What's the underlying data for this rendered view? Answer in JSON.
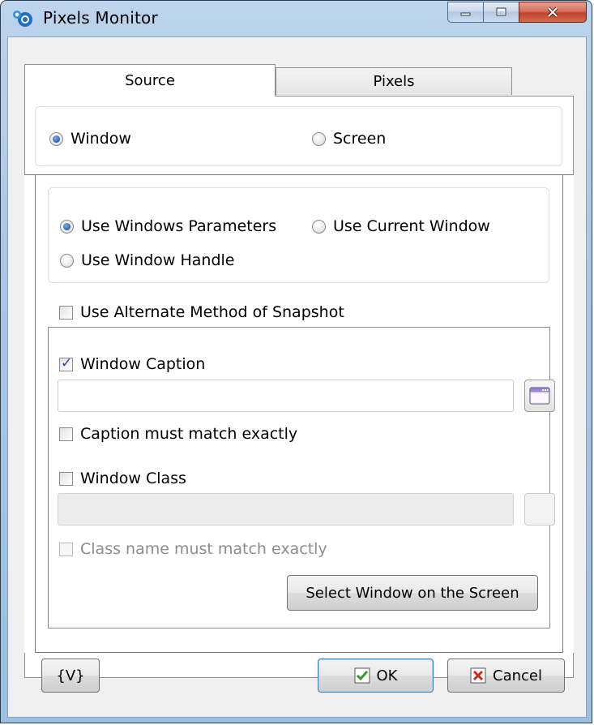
{
  "window": {
    "title": "Pixels Monitor",
    "icon": "pixels-monitor-app-icon",
    "controls": [
      "minimize-icon",
      "maximize-icon",
      "close-icon"
    ]
  },
  "tabs": [
    {
      "label": "Source",
      "active": true
    },
    {
      "label": "Pixels",
      "active": false
    }
  ],
  "source_mode": {
    "window_label": "Window",
    "screen_label": "Screen",
    "selected": "Window"
  },
  "window_method": {
    "use_windows_parameters": "Use Windows Parameters",
    "use_current_window": "Use Current Window",
    "use_window_handle": "Use Window Handle",
    "selected": "Use Windows Parameters"
  },
  "alternate_snapshot": {
    "label": "Use Alternate Method of Snapshot",
    "checked": false
  },
  "caption": {
    "label": "Window Caption",
    "checked": true,
    "value": "",
    "match_exact_label": "Caption must match exactly",
    "match_exact_checked": false
  },
  "window_class": {
    "label": "Window Class",
    "checked": false,
    "value": "",
    "match_exact_label": "Class name must match exactly",
    "match_exact_checked": false
  },
  "select_window_button": "Select Window on the Screen",
  "footer": {
    "variables_button": "{V}",
    "ok_button": "OK",
    "cancel_button": "Cancel"
  },
  "colors": {
    "titlebar": "#a9c6e4",
    "close_button": "#c0432a",
    "check_accent": "#1f4f9a",
    "ok_icon": "#2e9b2e",
    "cancel_icon": "#d0281c"
  }
}
